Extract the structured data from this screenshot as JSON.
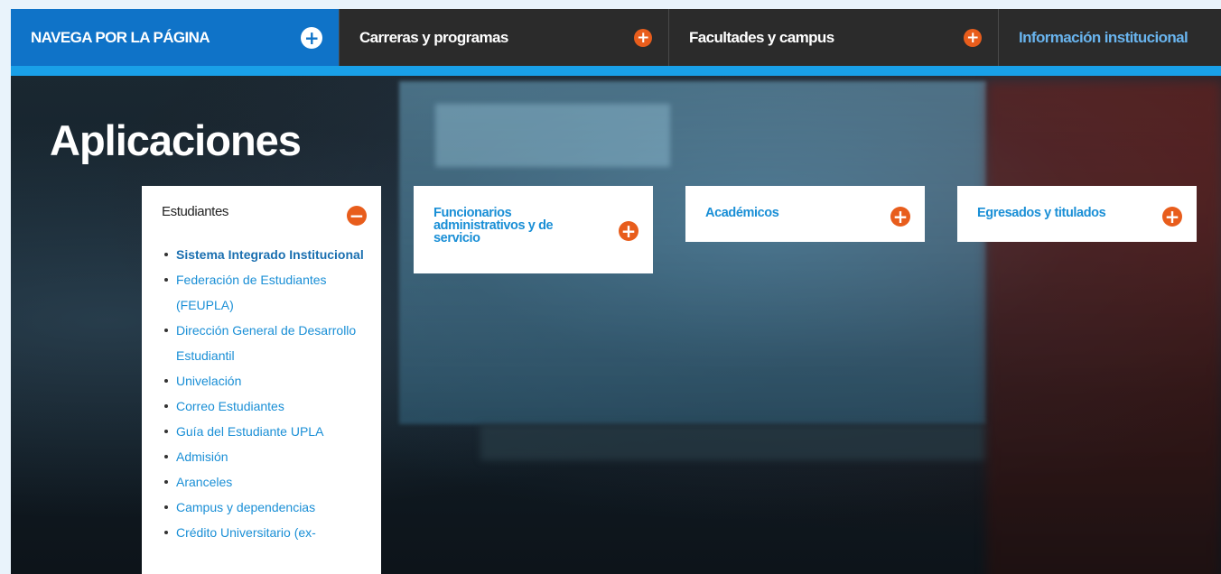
{
  "nav": {
    "items": [
      {
        "label": "NAVEGA POR LA PÁGINA",
        "icon": "plus-icon"
      },
      {
        "label": "Carreras y programas",
        "icon": "plus-icon"
      },
      {
        "label": "Facultades y campus",
        "icon": "plus-icon"
      },
      {
        "label": "Información institucional"
      }
    ]
  },
  "page": {
    "title": "Aplicaciones"
  },
  "cards": [
    {
      "title": "Estudiantes",
      "expanded": true,
      "icon": "minus-icon",
      "links": [
        "Sistema Integrado Institucional",
        "Federación de Estudiantes (FEUPLA)",
        "Dirección General de Desarrollo Estudiantil",
        "Univelación",
        "Correo Estudiantes",
        "Guía del Estudiante UPLA",
        "Admisión",
        "Aranceles",
        "Campus y dependencias",
        "Crédito Universitario (ex-"
      ]
    },
    {
      "title": "Funcionarios administrativos y de servicio",
      "icon": "plus-icon"
    },
    {
      "title": "Académicos",
      "icon": "plus-icon"
    },
    {
      "title": "Egresados y titulados",
      "icon": "plus-icon"
    }
  ],
  "colors": {
    "nav_active": "#0f73c8",
    "nav_dark": "#2b2b2b",
    "strip": "#19a0e8",
    "accent_orange": "#e85d1c",
    "link": "#1a8fd6"
  }
}
